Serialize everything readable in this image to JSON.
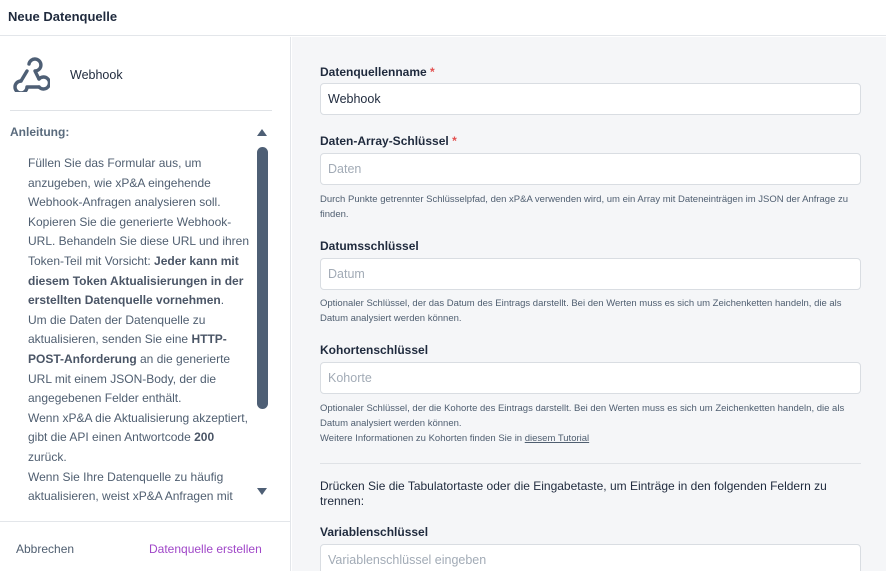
{
  "window": {
    "title": "Neue Datenquelle"
  },
  "sidebar": {
    "source_name": "Webhook",
    "source_icon": "webhook-icon",
    "guide_label": "Anleitung:",
    "guide_paragraphs": [
      [
        {
          "t": "Füllen Sie das Formular aus, um anzugeben, wie xP&A eingehende Webhook-Anfragen analysieren soll. Kopieren Sie die generierte Webhook-URL. Behandeln Sie diese URL und ihren Token-Teil mit Vorsicht: "
        },
        {
          "t": "Jeder kann mit diesem Token Aktualisierungen in der erstellten Datenquelle vornehmen",
          "b": true
        },
        {
          "t": "."
        }
      ],
      [
        {
          "t": "Um die Daten der Datenquelle zu aktualisieren, senden Sie eine "
        },
        {
          "t": "HTTP-POST-Anforderung",
          "b": true
        },
        {
          "t": " an die generierte URL mit einem JSON-Body, der die angegebenen Felder enthält."
        }
      ],
      [
        {
          "t": "Wenn xP&A die Aktualisierung akzeptiert, gibt die API einen Antwortcode "
        },
        {
          "t": "200",
          "b": true
        },
        {
          "t": " zurück."
        }
      ],
      [
        {
          "t": "Wenn Sie Ihre Datenquelle zu häufig aktualisieren, weist xP&A Anfragen mit"
        }
      ]
    ],
    "cancel_label": "Abbrechen",
    "create_label": "Datenquelle erstellen"
  },
  "form": {
    "name": {
      "label": "Datenquellenname",
      "required": "*",
      "value": "Webhook",
      "placeholder": ""
    },
    "array_key": {
      "label": "Daten-Array-Schlüssel",
      "required": "*",
      "value": "",
      "placeholder": "Daten",
      "help": "Durch Punkte getrennter Schlüsselpfad, den xP&A verwenden wird, um ein Array mit Dateneinträgen im JSON der Anfrage zu finden."
    },
    "date_key": {
      "label": "Datumsschlüssel",
      "value": "",
      "placeholder": "Datum",
      "help": "Optionaler Schlüssel, der das Datum des Eintrags darstellt. Bei den Werten muss es sich um Zeichenketten handeln, die als Datum analysiert werden können."
    },
    "cohort_key": {
      "label": "Kohortenschlüssel",
      "value": "",
      "placeholder": "Kohorte",
      "help": "Optionaler Schlüssel, der die Kohorte des Eintrags darstellt. Bei den Werten muss es sich um Zeichenketten handeln, die als Datum analysiert werden können.",
      "help2_prefix": "Weitere Informationen zu Kohorten finden Sie in ",
      "help2_link": "diesem Tutorial"
    },
    "tab_hint": "Drücken Sie die Tabulatortaste oder die Eingabetaste, um Einträge in den folgenden Feldern zu trennen:",
    "variable_key": {
      "label": "Variablenschlüssel",
      "value": "",
      "placeholder": "Variablenschlüssel eingeben"
    }
  }
}
